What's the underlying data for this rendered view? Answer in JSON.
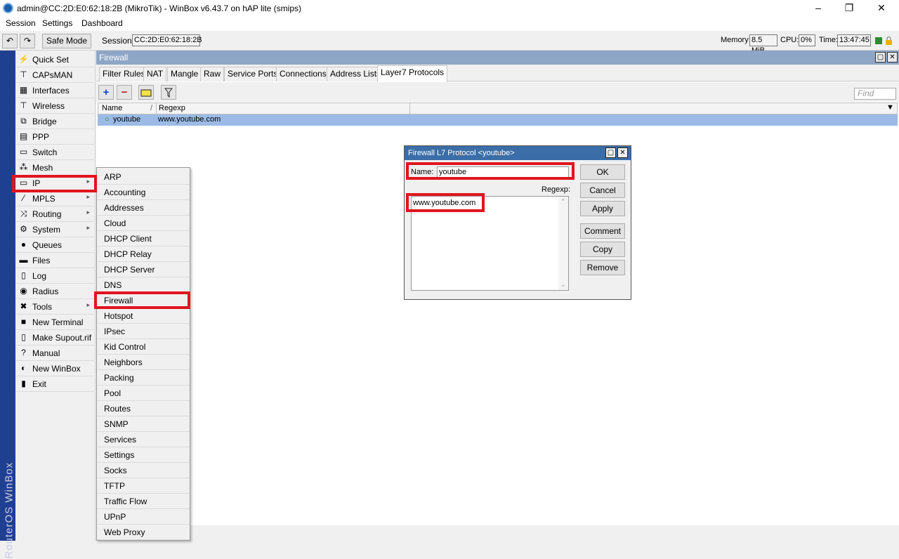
{
  "window": {
    "title": "admin@CC:2D:E0:62:18:2B (MikroTik) - WinBox v6.43.7 on hAP lite (smips)"
  },
  "menubar": [
    "Session",
    "Settings",
    "Dashboard"
  ],
  "toolbar": {
    "undo_icon": "undo-icon",
    "redo_icon": "redo-icon",
    "safe_mode_label": "Safe Mode",
    "session_label": "Session:",
    "session_value": "CC:2D:E0:62:18:2B",
    "memory_label": "Memory:",
    "memory_value": "8.5 MiB",
    "cpu_label": "CPU:",
    "cpu_value": "0%",
    "time_label": "Time:",
    "time_value": "13:47:45"
  },
  "vertical_brand": "RouterOS WinBox",
  "sidebar": {
    "items": [
      {
        "label": "Quick Set",
        "icon": "quickset-icon",
        "glyph": "⚡"
      },
      {
        "label": "CAPsMAN",
        "icon": "antenna-icon",
        "glyph": "⊤"
      },
      {
        "label": "Interfaces",
        "icon": "interfaces-icon",
        "glyph": "▦"
      },
      {
        "label": "Wireless",
        "icon": "wireless-icon",
        "glyph": "⊤"
      },
      {
        "label": "Bridge",
        "icon": "bridge-icon",
        "glyph": "⧉"
      },
      {
        "label": "PPP",
        "icon": "ppp-icon",
        "glyph": "▤"
      },
      {
        "label": "Switch",
        "icon": "switch-icon",
        "glyph": "▭"
      },
      {
        "label": "Mesh",
        "icon": "mesh-icon",
        "glyph": "⁂"
      },
      {
        "label": "IP",
        "icon": "ip-icon",
        "glyph": "▭",
        "submenu": true
      },
      {
        "label": "MPLS",
        "icon": "mpls-icon",
        "glyph": "⁄",
        "submenu": true
      },
      {
        "label": "Routing",
        "icon": "routing-icon",
        "glyph": "⤨",
        "submenu": true
      },
      {
        "label": "System",
        "icon": "system-gear-icon",
        "glyph": "⚙",
        "submenu": true
      },
      {
        "label": "Queues",
        "icon": "queues-icon",
        "glyph": "●"
      },
      {
        "label": "Files",
        "icon": "folder-icon",
        "glyph": "▬"
      },
      {
        "label": "Log",
        "icon": "log-icon",
        "glyph": "▯"
      },
      {
        "label": "Radius",
        "icon": "radius-icon",
        "glyph": "◉"
      },
      {
        "label": "Tools",
        "icon": "tools-icon",
        "glyph": "✖",
        "submenu": true
      },
      {
        "label": "New Terminal",
        "icon": "terminal-icon",
        "glyph": "■"
      },
      {
        "label": "Make Supout.rif",
        "icon": "supout-icon",
        "glyph": "▯"
      },
      {
        "label": "Manual",
        "icon": "help-icon",
        "glyph": "?"
      },
      {
        "label": "New WinBox",
        "icon": "winbox-icon",
        "glyph": "◐"
      },
      {
        "label": "Exit",
        "icon": "exit-icon",
        "glyph": "▮"
      }
    ]
  },
  "ip_submenu": {
    "items": [
      "ARP",
      "Accounting",
      "Addresses",
      "Cloud",
      "DHCP Client",
      "DHCP Relay",
      "DHCP Server",
      "DNS",
      "Firewall",
      "Hotspot",
      "IPsec",
      "Kid Control",
      "Neighbors",
      "Packing",
      "Pool",
      "Routes",
      "SNMP",
      "Services",
      "Settings",
      "Socks",
      "TFTP",
      "Traffic Flow",
      "UPnP",
      "Web Proxy"
    ]
  },
  "firewall": {
    "title": "Firewall",
    "tabs": [
      "Filter Rules",
      "NAT",
      "Mangle",
      "Raw",
      "Service Ports",
      "Connections",
      "Address Lists",
      "Layer7 Protocols"
    ],
    "active_tab": "Layer7 Protocols",
    "find_placeholder": "Find",
    "columns": [
      "Name",
      "Regexp"
    ],
    "sort_indicator": "/",
    "rows": [
      {
        "name": "youtube",
        "regexp": "www.youtube.com"
      }
    ]
  },
  "dialog": {
    "title": "Firewall L7 Protocol <youtube>",
    "name_label": "Name:",
    "name_value": "youtube",
    "regexp_label": "Regexp:",
    "regexp_value": "www.youtube.com",
    "buttons": {
      "ok": "OK",
      "cancel": "Cancel",
      "apply": "Apply",
      "comment": "Comment",
      "copy": "Copy",
      "remove": "Remove"
    }
  },
  "colors": {
    "highlight_red": "#e1151f",
    "brand_strip": "#1f3f91",
    "selected_row": "#9bbbe6",
    "dialog_title": "#3b6ea8"
  }
}
